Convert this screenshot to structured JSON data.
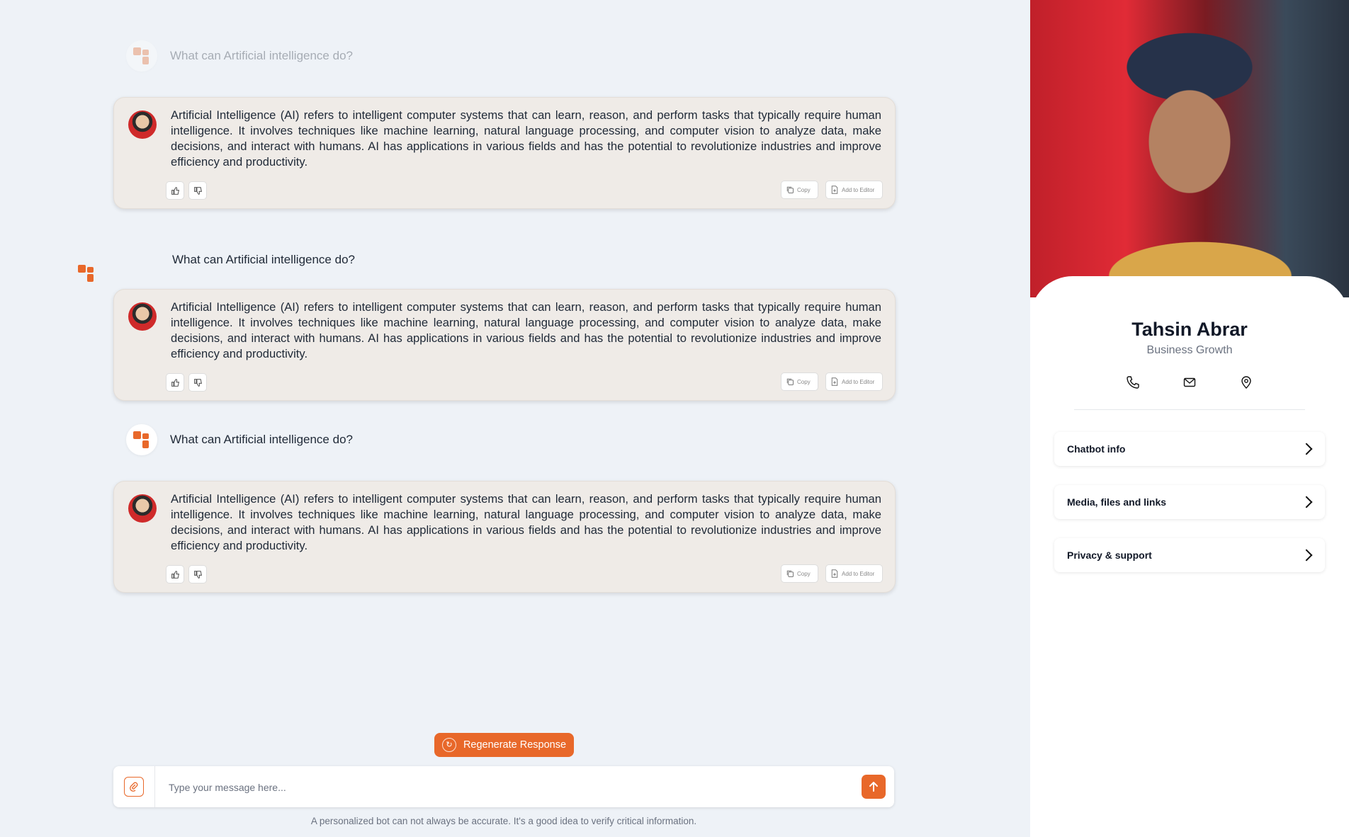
{
  "chat": {
    "question": "What can Artificial intelligence do?",
    "answer": "Artificial Intelligence (AI) refers to intelligent computer systems that can learn, reason, and perform tasks that typically require human intelligence. It involves techniques like machine learning, natural language processing, and computer vision to analyze data, make decisions, and interact with humans. AI has applications in various fields and has the potential to revolutionize industries and improve efficiency and productivity.",
    "copy_label": "Copy",
    "add_editor_label": "Add to Editor"
  },
  "regenerate_label": "Regenerate Response",
  "composer": {
    "placeholder": "Type your message here..."
  },
  "disclaimer": "A personalized bot can not always be accurate. It's a good idea to verify critical information.",
  "profile": {
    "name": "Tahsin Abrar",
    "role": "Business Growth",
    "items": [
      "Chatbot info",
      "Media, files and links",
      "Privacy & support"
    ]
  },
  "colors": {
    "accent": "#e8682a",
    "background": "#eef2f7",
    "card": "#efebe7"
  }
}
